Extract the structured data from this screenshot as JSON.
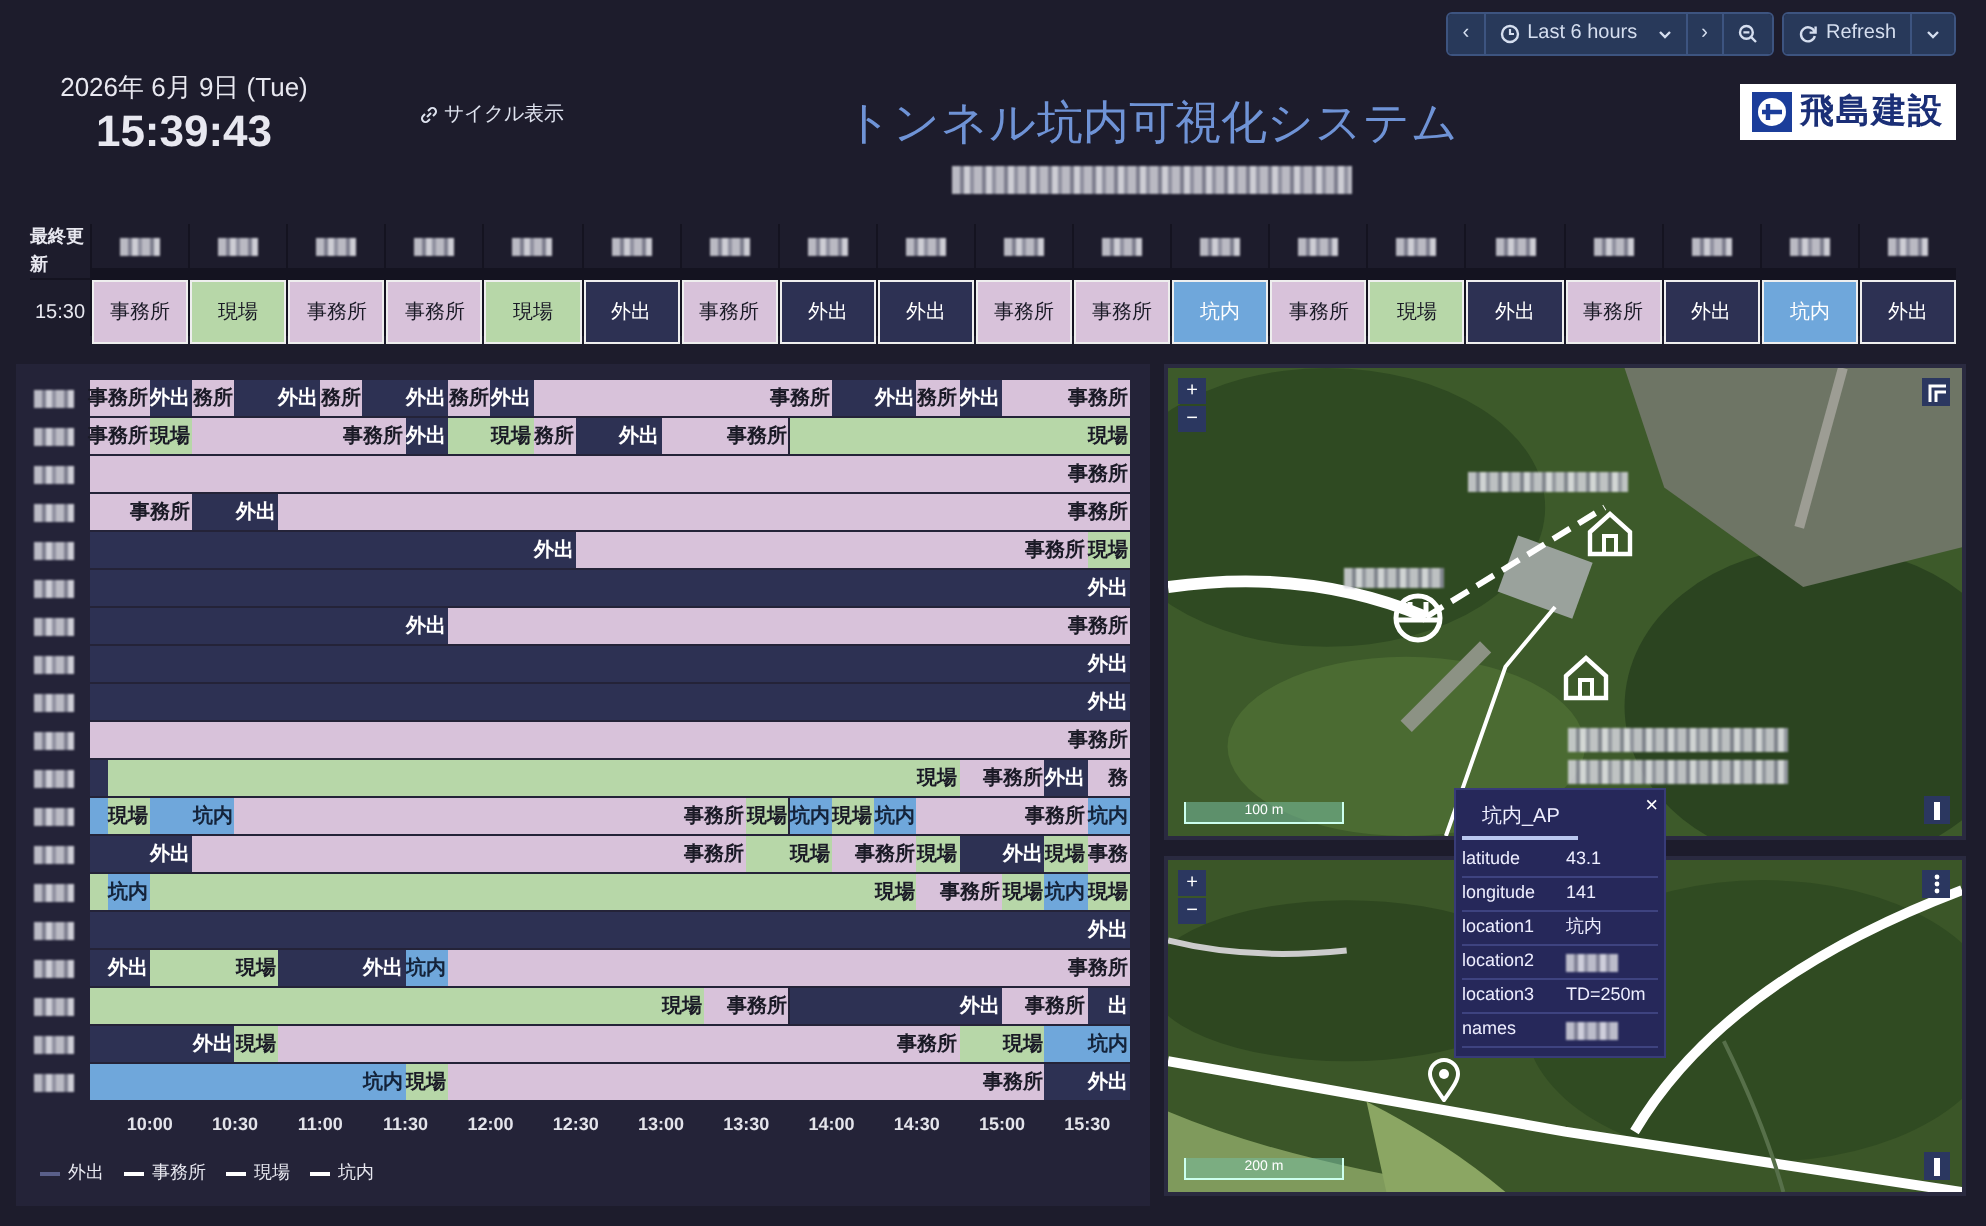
{
  "toolbar": {
    "prev": "‹",
    "range": "Last 6 hours",
    "next": "›",
    "refresh": "Refresh"
  },
  "clock": {
    "date": "2026年 6月 9日 (Tue)",
    "time": "15:39:43"
  },
  "cycle_link": "サイクル表示",
  "title": "トンネル坑内可視化システム",
  "logo": "飛島建設",
  "board": {
    "header": "最終更新",
    "time": "15:30",
    "cells": [
      {
        "kind": "office",
        "label": "事務所"
      },
      {
        "kind": "field",
        "label": "現場"
      },
      {
        "kind": "office",
        "label": "事務所"
      },
      {
        "kind": "office",
        "label": "事務所"
      },
      {
        "kind": "field",
        "label": "現場"
      },
      {
        "kind": "out",
        "label": "外出"
      },
      {
        "kind": "office",
        "label": "事務所"
      },
      {
        "kind": "out",
        "label": "外出"
      },
      {
        "kind": "out",
        "label": "外出"
      },
      {
        "kind": "office",
        "label": "事務所"
      },
      {
        "kind": "office",
        "label": "事務所"
      },
      {
        "kind": "tunnel",
        "label": "坑内"
      },
      {
        "kind": "office",
        "label": "事務所"
      },
      {
        "kind": "field",
        "label": "現場"
      },
      {
        "kind": "out",
        "label": "外出"
      },
      {
        "kind": "office",
        "label": "事務所"
      },
      {
        "kind": "out",
        "label": "外出"
      },
      {
        "kind": "tunnel",
        "label": "坑内"
      },
      {
        "kind": "out",
        "label": "外出"
      }
    ]
  },
  "timeline": {
    "rows": [
      {
        "slots": [
          {
            "kind": "office"
          },
          {
            "kind": "office",
            "label": "事務所"
          },
          {
            "kind": "out",
            "label": "外出"
          },
          {
            "kind": "office",
            "label": "務所"
          },
          {
            "kind": "out"
          },
          {
            "kind": "out",
            "label": "外出"
          },
          {
            "kind": "office",
            "label": "務所"
          },
          {
            "kind": "out"
          },
          {
            "kind": "out",
            "label": "外出"
          },
          {
            "kind": "office",
            "label": "務所"
          },
          {
            "kind": "out",
            "label": "外出"
          },
          {
            "kind": "office"
          },
          {
            "kind": "office"
          },
          {
            "kind": "office"
          },
          {
            "kind": "office"
          },
          {
            "kind": "office"
          },
          {
            "kind": "office"
          },
          {
            "kind": "office",
            "label": "事務所"
          },
          {
            "kind": "out"
          },
          {
            "kind": "out",
            "label": "外出"
          },
          {
            "kind": "office",
            "label": "務所"
          },
          {
            "kind": "out",
            "label": "外出"
          },
          {
            "kind": "office"
          },
          {
            "kind": "office"
          },
          {
            "kind": "office",
            "label": "事務所"
          }
        ]
      },
      {
        "slots": [
          {
            "kind": "office"
          },
          {
            "kind": "office",
            "label": "事務所"
          },
          {
            "kind": "field",
            "label": "現場"
          },
          {
            "kind": "office"
          },
          {
            "kind": "office"
          },
          {
            "kind": "office"
          },
          {
            "kind": "office"
          },
          {
            "kind": "office",
            "label": "事務所"
          },
          {
            "kind": "out",
            "label": "外出"
          },
          {
            "kind": "field"
          },
          {
            "kind": "field",
            "label": "現場"
          },
          {
            "kind": "office",
            "label": "務所"
          },
          {
            "kind": "out"
          },
          {
            "kind": "out",
            "label": "外出"
          },
          {
            "kind": "office"
          },
          {
            "kind": "office"
          },
          {
            "kind": "office",
            "label": "事務所"
          },
          {
            "kind": "field"
          },
          {
            "kind": "field"
          },
          {
            "kind": "field"
          },
          {
            "kind": "field"
          },
          {
            "kind": "field"
          },
          {
            "kind": "field"
          },
          {
            "kind": "field"
          },
          {
            "kind": "field",
            "label": "現場"
          }
        ]
      },
      {
        "slots": [
          {
            "kind": "office"
          },
          {
            "kind": "office"
          },
          {
            "kind": "office"
          },
          {
            "kind": "office"
          },
          {
            "kind": "office"
          },
          {
            "kind": "office"
          },
          {
            "kind": "office"
          },
          {
            "kind": "office"
          },
          {
            "kind": "office"
          },
          {
            "kind": "office"
          },
          {
            "kind": "office"
          },
          {
            "kind": "office"
          },
          {
            "kind": "office"
          },
          {
            "kind": "office"
          },
          {
            "kind": "office"
          },
          {
            "kind": "office"
          },
          {
            "kind": "office"
          },
          {
            "kind": "office"
          },
          {
            "kind": "office"
          },
          {
            "kind": "office"
          },
          {
            "kind": "office"
          },
          {
            "kind": "office"
          },
          {
            "kind": "office"
          },
          {
            "kind": "office"
          },
          {
            "kind": "office",
            "label": "事務所"
          }
        ]
      },
      {
        "slots": [
          {
            "kind": "office"
          },
          {
            "kind": "office"
          },
          {
            "kind": "office",
            "label": "事務所"
          },
          {
            "kind": "out"
          },
          {
            "kind": "out",
            "label": "外出"
          },
          {
            "kind": "office"
          },
          {
            "kind": "office"
          },
          {
            "kind": "office"
          },
          {
            "kind": "office"
          },
          {
            "kind": "office"
          },
          {
            "kind": "office"
          },
          {
            "kind": "office"
          },
          {
            "kind": "office"
          },
          {
            "kind": "office"
          },
          {
            "kind": "office"
          },
          {
            "kind": "office"
          },
          {
            "kind": "office"
          },
          {
            "kind": "office"
          },
          {
            "kind": "office"
          },
          {
            "kind": "office"
          },
          {
            "kind": "office"
          },
          {
            "kind": "office"
          },
          {
            "kind": "office"
          },
          {
            "kind": "office"
          },
          {
            "kind": "office",
            "label": "事務所"
          }
        ]
      },
      {
        "slots": [
          {
            "kind": "out"
          },
          {
            "kind": "out"
          },
          {
            "kind": "out"
          },
          {
            "kind": "out"
          },
          {
            "kind": "out"
          },
          {
            "kind": "out"
          },
          {
            "kind": "out"
          },
          {
            "kind": "out"
          },
          {
            "kind": "out"
          },
          {
            "kind": "out"
          },
          {
            "kind": "out"
          },
          {
            "kind": "out",
            "label": "外出"
          },
          {
            "kind": "office"
          },
          {
            "kind": "office"
          },
          {
            "kind": "office"
          },
          {
            "kind": "office"
          },
          {
            "kind": "office"
          },
          {
            "kind": "office"
          },
          {
            "kind": "office"
          },
          {
            "kind": "office"
          },
          {
            "kind": "office"
          },
          {
            "kind": "office"
          },
          {
            "kind": "office"
          },
          {
            "kind": "office",
            "label": "事務所"
          },
          {
            "kind": "field",
            "label": "現場"
          }
        ]
      },
      {
        "slots": [
          {
            "kind": "out"
          },
          {
            "kind": "out"
          },
          {
            "kind": "out"
          },
          {
            "kind": "out"
          },
          {
            "kind": "out"
          },
          {
            "kind": "out"
          },
          {
            "kind": "out"
          },
          {
            "kind": "out"
          },
          {
            "kind": "out"
          },
          {
            "kind": "out"
          },
          {
            "kind": "out"
          },
          {
            "kind": "out"
          },
          {
            "kind": "out"
          },
          {
            "kind": "out"
          },
          {
            "kind": "out"
          },
          {
            "kind": "out"
          },
          {
            "kind": "out"
          },
          {
            "kind": "out"
          },
          {
            "kind": "out"
          },
          {
            "kind": "out"
          },
          {
            "kind": "out"
          },
          {
            "kind": "out"
          },
          {
            "kind": "out"
          },
          {
            "kind": "out"
          },
          {
            "kind": "out",
            "label": "外出"
          }
        ]
      },
      {
        "slots": [
          {
            "kind": "out"
          },
          {
            "kind": "out"
          },
          {
            "kind": "out"
          },
          {
            "kind": "out"
          },
          {
            "kind": "out"
          },
          {
            "kind": "out"
          },
          {
            "kind": "out"
          },
          {
            "kind": "out"
          },
          {
            "kind": "out",
            "label": "外出"
          },
          {
            "kind": "office"
          },
          {
            "kind": "office"
          },
          {
            "kind": "office"
          },
          {
            "kind": "office"
          },
          {
            "kind": "office"
          },
          {
            "kind": "office"
          },
          {
            "kind": "office"
          },
          {
            "kind": "office"
          },
          {
            "kind": "office"
          },
          {
            "kind": "office"
          },
          {
            "kind": "office"
          },
          {
            "kind": "office"
          },
          {
            "kind": "office"
          },
          {
            "kind": "office"
          },
          {
            "kind": "office"
          },
          {
            "kind": "office",
            "label": "事務所"
          }
        ]
      },
      {
        "slots": [
          {
            "kind": "out"
          },
          {
            "kind": "out"
          },
          {
            "kind": "out"
          },
          {
            "kind": "out"
          },
          {
            "kind": "out"
          },
          {
            "kind": "out"
          },
          {
            "kind": "out"
          },
          {
            "kind": "out"
          },
          {
            "kind": "out"
          },
          {
            "kind": "out"
          },
          {
            "kind": "out"
          },
          {
            "kind": "out"
          },
          {
            "kind": "out"
          },
          {
            "kind": "out"
          },
          {
            "kind": "out"
          },
          {
            "kind": "out"
          },
          {
            "kind": "out"
          },
          {
            "kind": "out"
          },
          {
            "kind": "out"
          },
          {
            "kind": "out"
          },
          {
            "kind": "out"
          },
          {
            "kind": "out"
          },
          {
            "kind": "out"
          },
          {
            "kind": "out"
          },
          {
            "kind": "out",
            "label": "外出"
          }
        ]
      },
      {
        "slots": [
          {
            "kind": "out"
          },
          {
            "kind": "out"
          },
          {
            "kind": "out"
          },
          {
            "kind": "out"
          },
          {
            "kind": "out"
          },
          {
            "kind": "out"
          },
          {
            "kind": "out"
          },
          {
            "kind": "out"
          },
          {
            "kind": "out"
          },
          {
            "kind": "out"
          },
          {
            "kind": "out"
          },
          {
            "kind": "out"
          },
          {
            "kind": "out"
          },
          {
            "kind": "out"
          },
          {
            "kind": "out"
          },
          {
            "kind": "out"
          },
          {
            "kind": "out"
          },
          {
            "kind": "out"
          },
          {
            "kind": "out"
          },
          {
            "kind": "out"
          },
          {
            "kind": "out"
          },
          {
            "kind": "out"
          },
          {
            "kind": "out"
          },
          {
            "kind": "out"
          },
          {
            "kind": "out",
            "label": "外出"
          }
        ]
      },
      {
        "slots": [
          {
            "kind": "office"
          },
          {
            "kind": "office"
          },
          {
            "kind": "office"
          },
          {
            "kind": "office"
          },
          {
            "kind": "office"
          },
          {
            "kind": "office"
          },
          {
            "kind": "office"
          },
          {
            "kind": "office"
          },
          {
            "kind": "office"
          },
          {
            "kind": "office"
          },
          {
            "kind": "office"
          },
          {
            "kind": "office"
          },
          {
            "kind": "office"
          },
          {
            "kind": "office"
          },
          {
            "kind": "office"
          },
          {
            "kind": "office"
          },
          {
            "kind": "office"
          },
          {
            "kind": "office"
          },
          {
            "kind": "office"
          },
          {
            "kind": "office"
          },
          {
            "kind": "office"
          },
          {
            "kind": "office"
          },
          {
            "kind": "office"
          },
          {
            "kind": "office"
          },
          {
            "kind": "office",
            "label": "事務所"
          }
        ]
      },
      {
        "slots": [
          {
            "kind": "out"
          },
          {
            "kind": "field"
          },
          {
            "kind": "field"
          },
          {
            "kind": "field"
          },
          {
            "kind": "field"
          },
          {
            "kind": "field"
          },
          {
            "kind": "field"
          },
          {
            "kind": "field"
          },
          {
            "kind": "field"
          },
          {
            "kind": "field"
          },
          {
            "kind": "field"
          },
          {
            "kind": "field"
          },
          {
            "kind": "field"
          },
          {
            "kind": "field"
          },
          {
            "kind": "field"
          },
          {
            "kind": "field"
          },
          {
            "kind": "field"
          },
          {
            "kind": "field"
          },
          {
            "kind": "field"
          },
          {
            "kind": "field"
          },
          {
            "kind": "field",
            "label": "現場"
          },
          {
            "kind": "office"
          },
          {
            "kind": "office",
            "label": "事務所"
          },
          {
            "kind": "out",
            "label": "外出"
          },
          {
            "kind": "office",
            "label": "務"
          }
        ]
      },
      {
        "slots": [
          {
            "kind": "tunnel"
          },
          {
            "kind": "field",
            "label": "現場"
          },
          {
            "kind": "tunnel"
          },
          {
            "kind": "tunnel",
            "label": "坑内"
          },
          {
            "kind": "office"
          },
          {
            "kind": "office"
          },
          {
            "kind": "office"
          },
          {
            "kind": "office"
          },
          {
            "kind": "office"
          },
          {
            "kind": "office"
          },
          {
            "kind": "office"
          },
          {
            "kind": "office"
          },
          {
            "kind": "office"
          },
          {
            "kind": "office"
          },
          {
            "kind": "office"
          },
          {
            "kind": "office",
            "label": "事務所"
          },
          {
            "kind": "field",
            "label": "現場"
          },
          {
            "kind": "tunnel",
            "label": "坑内"
          },
          {
            "kind": "field",
            "label": "現場"
          },
          {
            "kind": "tunnel",
            "label": "坑内"
          },
          {
            "kind": "office"
          },
          {
            "kind": "office"
          },
          {
            "kind": "office"
          },
          {
            "kind": "office",
            "label": "事務所"
          },
          {
            "kind": "tunnel",
            "label": "坑内"
          }
        ]
      },
      {
        "slots": [
          {
            "kind": "out"
          },
          {
            "kind": "out"
          },
          {
            "kind": "out",
            "label": "外出"
          },
          {
            "kind": "office"
          },
          {
            "kind": "office"
          },
          {
            "kind": "office"
          },
          {
            "kind": "office"
          },
          {
            "kind": "office"
          },
          {
            "kind": "office"
          },
          {
            "kind": "office"
          },
          {
            "kind": "office"
          },
          {
            "kind": "office"
          },
          {
            "kind": "office"
          },
          {
            "kind": "office"
          },
          {
            "kind": "office"
          },
          {
            "kind": "office",
            "label": "事務所"
          },
          {
            "kind": "field"
          },
          {
            "kind": "field",
            "label": "現場"
          },
          {
            "kind": "office"
          },
          {
            "kind": "office",
            "label": "事務所"
          },
          {
            "kind": "field",
            "label": "現場"
          },
          {
            "kind": "out"
          },
          {
            "kind": "out",
            "label": "外出"
          },
          {
            "kind": "field",
            "label": "現場"
          },
          {
            "kind": "office",
            "label": "事務"
          }
        ]
      },
      {
        "slots": [
          {
            "kind": "field"
          },
          {
            "kind": "tunnel",
            "label": "坑内"
          },
          {
            "kind": "field"
          },
          {
            "kind": "field"
          },
          {
            "kind": "field"
          },
          {
            "kind": "field"
          },
          {
            "kind": "field"
          },
          {
            "kind": "field"
          },
          {
            "kind": "field"
          },
          {
            "kind": "field"
          },
          {
            "kind": "field"
          },
          {
            "kind": "field"
          },
          {
            "kind": "field"
          },
          {
            "kind": "field"
          },
          {
            "kind": "field"
          },
          {
            "kind": "field"
          },
          {
            "kind": "field"
          },
          {
            "kind": "field"
          },
          {
            "kind": "field"
          },
          {
            "kind": "field",
            "label": "現場"
          },
          {
            "kind": "office"
          },
          {
            "kind": "office",
            "label": "事務所"
          },
          {
            "kind": "field",
            "label": "現場"
          },
          {
            "kind": "tunnel",
            "label": "坑内"
          },
          {
            "kind": "field",
            "label": "現場"
          }
        ]
      },
      {
        "slots": [
          {
            "kind": "out"
          },
          {
            "kind": "out"
          },
          {
            "kind": "out"
          },
          {
            "kind": "out"
          },
          {
            "kind": "out"
          },
          {
            "kind": "out"
          },
          {
            "kind": "out"
          },
          {
            "kind": "out"
          },
          {
            "kind": "out"
          },
          {
            "kind": "out"
          },
          {
            "kind": "out"
          },
          {
            "kind": "out"
          },
          {
            "kind": "out"
          },
          {
            "kind": "out"
          },
          {
            "kind": "out"
          },
          {
            "kind": "out"
          },
          {
            "kind": "out"
          },
          {
            "kind": "out"
          },
          {
            "kind": "out"
          },
          {
            "kind": "out"
          },
          {
            "kind": "out"
          },
          {
            "kind": "out"
          },
          {
            "kind": "out"
          },
          {
            "kind": "out"
          },
          {
            "kind": "out",
            "label": "外出"
          }
        ]
      },
      {
        "slots": [
          {
            "kind": "out"
          },
          {
            "kind": "out",
            "label": "外出"
          },
          {
            "kind": "field"
          },
          {
            "kind": "field"
          },
          {
            "kind": "field",
            "label": "現場"
          },
          {
            "kind": "out"
          },
          {
            "kind": "out"
          },
          {
            "kind": "out",
            "label": "外出"
          },
          {
            "kind": "tunnel",
            "label": "坑内"
          },
          {
            "kind": "office"
          },
          {
            "kind": "office"
          },
          {
            "kind": "office"
          },
          {
            "kind": "office"
          },
          {
            "kind": "office"
          },
          {
            "kind": "office"
          },
          {
            "kind": "office"
          },
          {
            "kind": "office"
          },
          {
            "kind": "office"
          },
          {
            "kind": "office"
          },
          {
            "kind": "office"
          },
          {
            "kind": "office"
          },
          {
            "kind": "office"
          },
          {
            "kind": "office"
          },
          {
            "kind": "office"
          },
          {
            "kind": "office",
            "label": "事務所"
          }
        ]
      },
      {
        "slots": [
          {
            "kind": "field"
          },
          {
            "kind": "field"
          },
          {
            "kind": "field"
          },
          {
            "kind": "field"
          },
          {
            "kind": "field"
          },
          {
            "kind": "field"
          },
          {
            "kind": "field"
          },
          {
            "kind": "field"
          },
          {
            "kind": "field"
          },
          {
            "kind": "field"
          },
          {
            "kind": "field"
          },
          {
            "kind": "field"
          },
          {
            "kind": "field"
          },
          {
            "kind": "field"
          },
          {
            "kind": "field",
            "label": "現場"
          },
          {
            "kind": "office"
          },
          {
            "kind": "office",
            "label": "事務所"
          },
          {
            "kind": "out"
          },
          {
            "kind": "out"
          },
          {
            "kind": "out"
          },
          {
            "kind": "out"
          },
          {
            "kind": "out",
            "label": "外出"
          },
          {
            "kind": "office"
          },
          {
            "kind": "office",
            "label": "事務所"
          },
          {
            "kind": "out",
            "label": "出"
          }
        ]
      },
      {
        "slots": [
          {
            "kind": "out"
          },
          {
            "kind": "out"
          },
          {
            "kind": "out"
          },
          {
            "kind": "out",
            "label": "外出"
          },
          {
            "kind": "field",
            "label": "現場"
          },
          {
            "kind": "office"
          },
          {
            "kind": "office"
          },
          {
            "kind": "office"
          },
          {
            "kind": "office"
          },
          {
            "kind": "office"
          },
          {
            "kind": "office"
          },
          {
            "kind": "office"
          },
          {
            "kind": "office"
          },
          {
            "kind": "office"
          },
          {
            "kind": "office"
          },
          {
            "kind": "office"
          },
          {
            "kind": "office"
          },
          {
            "kind": "office"
          },
          {
            "kind": "office"
          },
          {
            "kind": "office"
          },
          {
            "kind": "office",
            "label": "事務所"
          },
          {
            "kind": "field"
          },
          {
            "kind": "field",
            "label": "現場"
          },
          {
            "kind": "tunnel"
          },
          {
            "kind": "tunnel",
            "label": "坑内"
          }
        ]
      },
      {
        "slots": [
          {
            "kind": "tunnel"
          },
          {
            "kind": "tunnel"
          },
          {
            "kind": "tunnel"
          },
          {
            "kind": "tunnel"
          },
          {
            "kind": "tunnel"
          },
          {
            "kind": "tunnel"
          },
          {
            "kind": "tunnel"
          },
          {
            "kind": "tunnel",
            "label": "坑内"
          },
          {
            "kind": "field",
            "label": "現場"
          },
          {
            "kind": "office"
          },
          {
            "kind": "office"
          },
          {
            "kind": "office"
          },
          {
            "kind": "office"
          },
          {
            "kind": "office"
          },
          {
            "kind": "office"
          },
          {
            "kind": "office"
          },
          {
            "kind": "office"
          },
          {
            "kind": "office"
          },
          {
            "kind": "office"
          },
          {
            "kind": "office"
          },
          {
            "kind": "office"
          },
          {
            "kind": "office"
          },
          {
            "kind": "office",
            "label": "事務所"
          },
          {
            "kind": "out"
          },
          {
            "kind": "out",
            "label": "外出"
          }
        ]
      }
    ],
    "ticks": [
      "10:00",
      "10:30",
      "11:00",
      "11:30",
      "12:00",
      "12:30",
      "13:00",
      "13:30",
      "14:00",
      "14:30",
      "15:00",
      "15:30"
    ]
  },
  "legend": [
    {
      "kind": "out",
      "label": "外出"
    },
    {
      "kind": "office",
      "label": "事務所"
    },
    {
      "kind": "field",
      "label": "現場"
    },
    {
      "kind": "tunnel",
      "label": "坑内"
    }
  ],
  "maps": [
    {
      "zoom_in": "+",
      "zoom_out": "−",
      "scale": "100 m"
    },
    {
      "zoom_in": "+",
      "zoom_out": "−",
      "scale": "200 m"
    }
  ],
  "popup": {
    "title": "坑内_AP",
    "close": "×",
    "rows": [
      {
        "key": "latitude",
        "value": "43.1"
      },
      {
        "key": "longitude",
        "value": "141"
      },
      {
        "key": "location1",
        "value": "坑内"
      },
      {
        "key": "location2"
      },
      {
        "key": "location3",
        "value": "TD=250m"
      },
      {
        "key": "names"
      }
    ]
  }
}
